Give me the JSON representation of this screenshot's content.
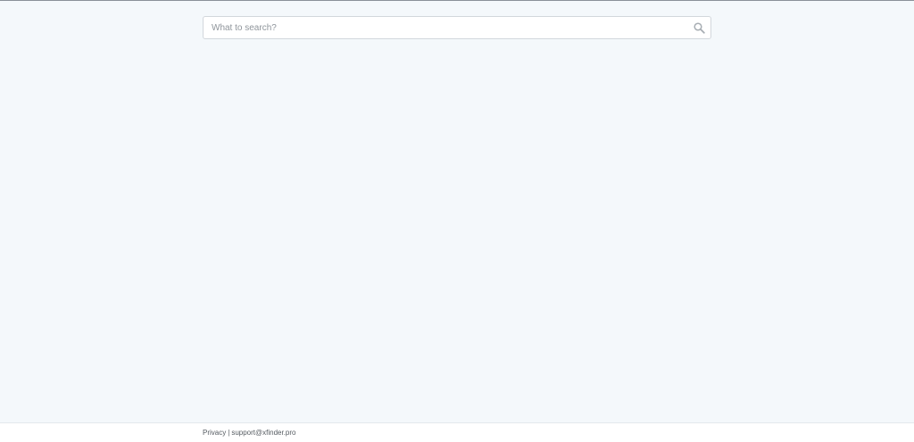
{
  "search": {
    "placeholder": "What to search?",
    "value": "",
    "icon": "search-icon"
  },
  "footer": {
    "privacy_label": "Privacy",
    "separator": "|",
    "support_email": "support@xfinder.pro"
  },
  "colors": {
    "background": "#f4f8fb",
    "footer_background": "#ffffff",
    "input_border": "#d2d7dc",
    "placeholder_text": "#8f959b",
    "footer_text": "#555b61"
  }
}
